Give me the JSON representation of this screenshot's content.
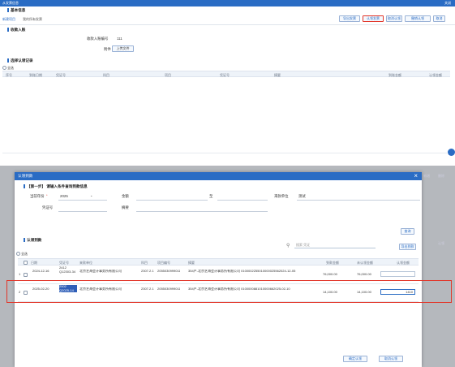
{
  "bg": {
    "title": "从发票信息",
    "close": "关闭",
    "section1": "基本信息",
    "tabs": [
      "新建项目",
      "我的所有发票"
    ],
    "buttons": [
      "导出发票",
      "认领发票",
      "取消认领",
      "撤销认领",
      "取消"
    ],
    "section2": "收款入账",
    "ref_label": "收款入账编号",
    "ref_value": "111",
    "attach_label": "附件",
    "attach_button": "上传文件",
    "section3": "选择认领记录",
    "select_all": "全选",
    "table_headers": [
      "序号",
      "到账日期",
      "凭证号",
      "科目",
      "项目",
      "凭证号",
      "摘要",
      "到账金额",
      "认领金额"
    ],
    "right_cut_1": "新增",
    "right_cut_2": "删除",
    "right_cut_3": "认领"
  },
  "modal": {
    "title": "认领到款",
    "close_icon": "close-icon",
    "step_title": "【第一步】 请输入条件查询到款信息",
    "filters": {
      "year_label": "当前年份",
      "year_value": "2025",
      "amount_label": "金额",
      "amount_to": "至",
      "payer_label": "来款单位",
      "payer_value": "测试",
      "voucher_label": "凭证号",
      "summary_label": "摘要"
    },
    "query_button": "查询",
    "section_title": "认领到款",
    "search_placeholder": "搜索 凭证",
    "export_button": "导出到款",
    "select_all": "全选",
    "table_headers": [
      "日期",
      "凭证号",
      "来款单位",
      "科目",
      "项目编号",
      "摘要",
      "到款金额",
      "未认领金额",
      "认领金额"
    ],
    "rows": [
      {
        "index": "1",
        "date": "2024-12-16",
        "voucher": "2412 Q12303-34",
        "payer": "北京艺海会计事务所有限公司",
        "subject": "2307.2.1.3",
        "project": "20550309990118",
        "summary": "354户-北京艺海会计事务所有限公司 0100002255010000025562024-12-05",
        "amount": "76,000.00",
        "unclaimed": "76,000.00",
        "claim": ""
      },
      {
        "index": "2",
        "date": "2025-02-20",
        "voucher": "2502 Q2025-14",
        "payer": "北京艺海会计事务所有限公司",
        "subject": "2307.2.1.3",
        "project": "20550309990118",
        "summary": "354户-北京艺海会计事务所有限公司 0100000881010000662025-02-10",
        "amount": "14,100.00",
        "unclaimed": "14,100.00",
        "claim": "1410"
      }
    ],
    "confirm_button": "确定认领",
    "cancel_button": "取消认领"
  }
}
